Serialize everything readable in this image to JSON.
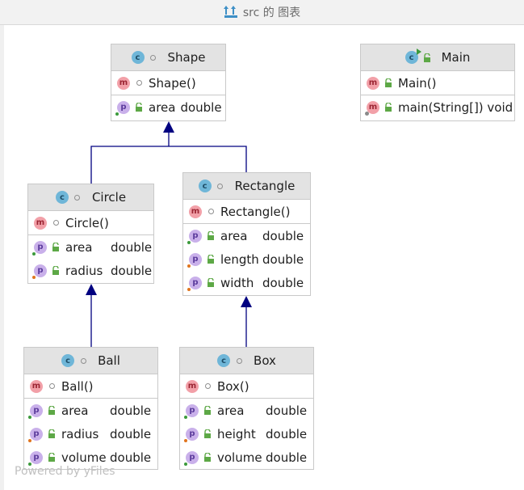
{
  "window": {
    "title": "src 的 图表"
  },
  "colors": {
    "edge": "#000080"
  },
  "watermark": "Powered by yFiles",
  "classes": {
    "shape": {
      "name": "Shape",
      "constructors": [
        "Shape()"
      ],
      "fields": [
        {
          "name": "area",
          "type": "double"
        }
      ]
    },
    "main": {
      "name": "Main",
      "constructors": [
        "Main()"
      ],
      "methods": [
        "main(String[]) void"
      ]
    },
    "circle": {
      "name": "Circle",
      "constructors": [
        "Circle()"
      ],
      "fields": [
        {
          "name": "area",
          "type": "double"
        },
        {
          "name": "radius",
          "type": "double"
        }
      ]
    },
    "rectangle": {
      "name": "Rectangle",
      "constructors": [
        "Rectangle()"
      ],
      "fields": [
        {
          "name": "area",
          "type": "double"
        },
        {
          "name": "length",
          "type": "double"
        },
        {
          "name": "width",
          "type": "double"
        }
      ]
    },
    "ball": {
      "name": "Ball",
      "constructors": [
        "Ball()"
      ],
      "fields": [
        {
          "name": "area",
          "type": "double"
        },
        {
          "name": "radius",
          "type": "double"
        },
        {
          "name": "volume",
          "type": "double"
        }
      ]
    },
    "box": {
      "name": "Box",
      "constructors": [
        "Box()"
      ],
      "fields": [
        {
          "name": "area",
          "type": "double"
        },
        {
          "name": "height",
          "type": "double"
        },
        {
          "name": "volume",
          "type": "double"
        }
      ]
    }
  }
}
